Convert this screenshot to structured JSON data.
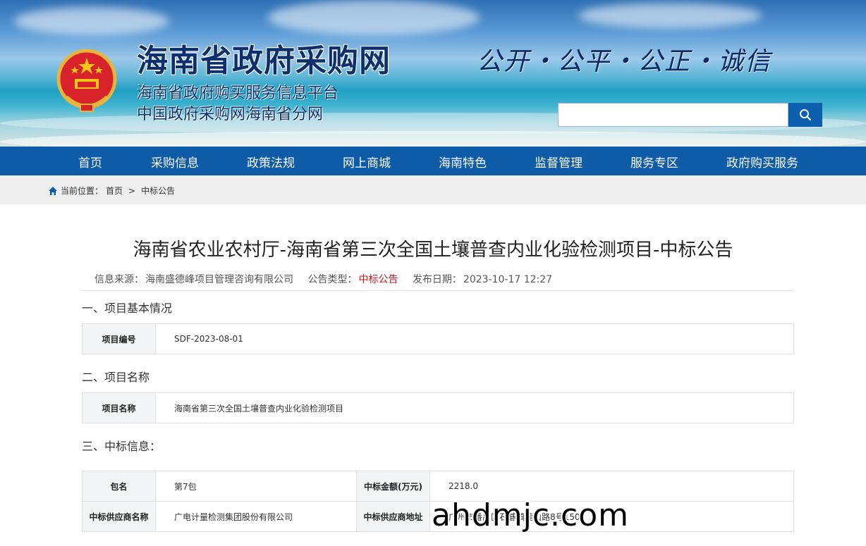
{
  "header": {
    "site_title": "海南省政府采购网",
    "subtitle_1": "海南省政府购买服务信息平台",
    "subtitle_2": "中国政府采购网海南省分网",
    "slogan": "公开・公平・公正・诚信",
    "search": {
      "value": "",
      "placeholder": ""
    },
    "search_icon": "search-icon",
    "emblem_icon": "national-emblem-icon",
    "colors": {
      "nav": "#0e5ba8",
      "accent_red": "#c8151b"
    }
  },
  "nav": {
    "items": [
      {
        "label": "首页"
      },
      {
        "label": "采购信息"
      },
      {
        "label": "政策法规"
      },
      {
        "label": "网上商城"
      },
      {
        "label": "海南特色"
      },
      {
        "label": "监督管理"
      },
      {
        "label": "服务专区"
      },
      {
        "label": "政府购买服务"
      }
    ]
  },
  "breadcrumb": {
    "home_icon": "home-icon",
    "prefix": "当前位置：",
    "home": "首页",
    "separator": ">",
    "current": "中标公告"
  },
  "article": {
    "title": "海南省农业农村厅-海南省第三次全国土壤普查内业化验检测项目-中标公告",
    "source_label": "信息来源：",
    "source": "海南盛德峰项目管理咨询有限公司",
    "type_label": "公告类型：",
    "type": "中标公告",
    "date_label": "发布日期：",
    "date": "2023-10-17 12:27"
  },
  "sections": {
    "s1": {
      "heading": "一、项目基本情况",
      "label": "项目编号",
      "value": "SDF-2023-08-01"
    },
    "s2": {
      "heading": "二、项目名称",
      "label": "项目名称",
      "value": "海南省第三次全国土壤普查内业化验检测项目"
    },
    "s3": {
      "heading": "三、中标信息：",
      "row1": {
        "l1": "包名",
        "v1": "第7包",
        "l2": "中标金额(万元)",
        "v2": "2218.0"
      },
      "row2": {
        "l1": "中标供应商名称",
        "v1": "广电计量检测集团股份有限公司",
        "l2": "中标供应商地址",
        "v2": "广州市番禺区石碁镇莲山路8号150"
      }
    }
  },
  "watermark": "ahdmjc.com"
}
